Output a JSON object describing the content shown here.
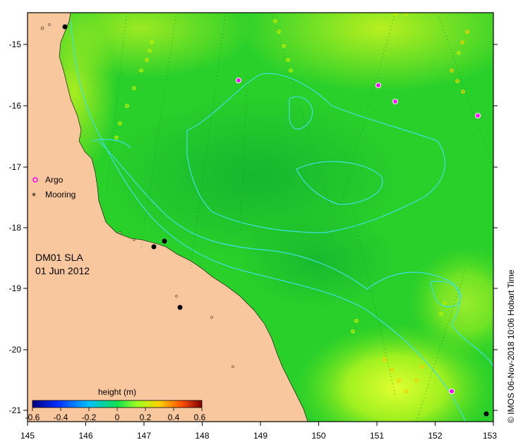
{
  "map": {
    "product_label": "DM01 SLA",
    "date_label": "01 Jun 2012",
    "credit": "© IMOS 06-Nov-2018 10:06 Hobart Time",
    "lon_ticks": [
      "145",
      "146",
      "147",
      "148",
      "149",
      "150",
      "151",
      "152",
      "153"
    ],
    "lat_ticks": [
      "-15",
      "-16",
      "-17",
      "-18",
      "-19",
      "-20",
      "-21"
    ],
    "legend": {
      "argo_label": "Argo",
      "mooring_label": "Mooring",
      "argo_color": "#ff00ff",
      "mooring_color": "#000000"
    },
    "colorbar": {
      "title": "height (m)",
      "ticks": [
        "-0.6",
        "-0.4",
        "-0.2",
        "0",
        "0.2",
        "0.4",
        "0.6"
      ],
      "colors": [
        "#000080",
        "#0040ff",
        "#00c0ff",
        "#00e060",
        "#a0ff20",
        "#ffc000",
        "#ff4000",
        "#800000"
      ]
    },
    "colors": {
      "land": "#f9c79d",
      "ocean_base": "#22cc22",
      "contour": "#40e0e0"
    }
  }
}
